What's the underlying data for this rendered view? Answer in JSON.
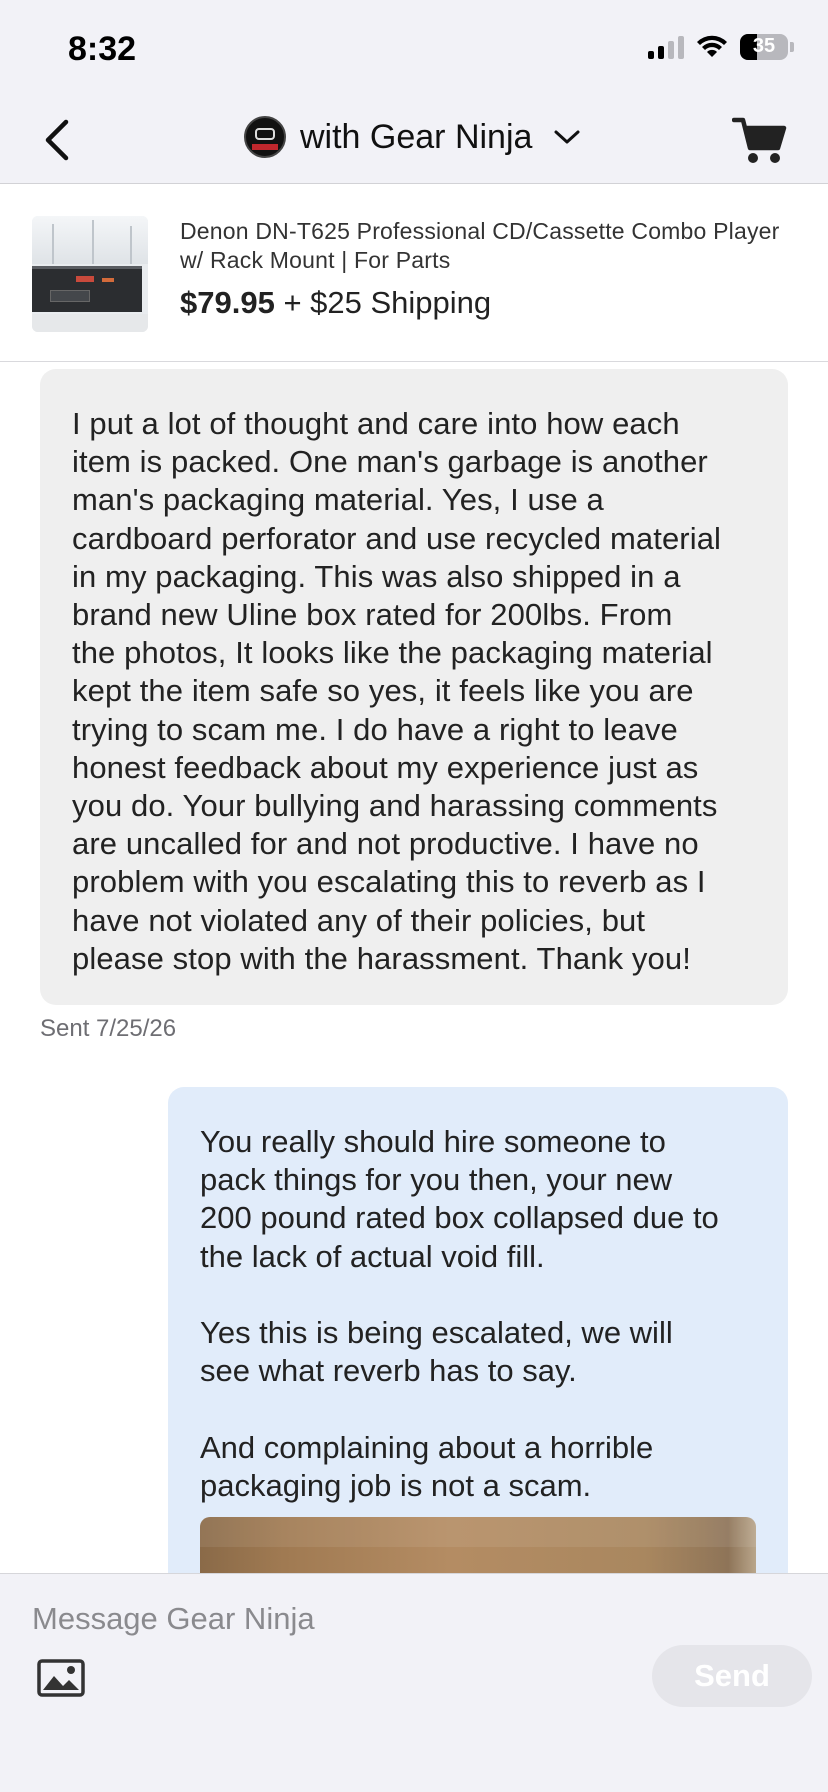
{
  "status_bar": {
    "time": "8:32",
    "battery": "35",
    "battery_level": 0.35
  },
  "nav": {
    "title": "with Gear Ninja"
  },
  "product": {
    "title": "Denon DN-T625 Professional CD/Cassette Combo Player w/ Rack Mount | For Parts",
    "price": "$79.95",
    "shipping": " + $25 Shipping"
  },
  "messages": [
    {
      "direction": "incoming",
      "text": "I put a lot of thought and care into how each\nitem is packed. One man's garbage is another\nman's packaging material. Yes, I use a\ncardboard perforator and use recycled material\nin my packaging. This was also shipped in a\nbrand new Uline box rated for 200lbs. From\nthe photos, It looks like the packaging material\nkept the item safe so yes, it feels like you are\ntrying to scam me. I do have a right to leave\nhonest feedback about my experience just as\nyou do. Your bullying and harassing comments\nare uncalled for and not productive. I have no\nproblem with you escalating this to reverb as I\nhave not violated any of their policies, but\nplease stop with the harassment. Thank you!",
      "status": "Sent 7/25/26"
    },
    {
      "direction": "outgoing",
      "text": "You really should hire someone to\npack things for you then, your new\n200 pound rated box collapsed due to\nthe lack of actual void fill.\n\n Yes this is being escalated, we will\nsee what reverb has to say.\n\n And complaining about a horrible\npackaging job is not a scam."
    }
  ],
  "composer": {
    "placeholder": "Message Gear Ninja",
    "send_label": "Send"
  },
  "colors": {
    "incoming_bubble": "#efefef",
    "outgoing_bubble": "#e1ecfa",
    "bar_background": "#f2f2f7"
  }
}
